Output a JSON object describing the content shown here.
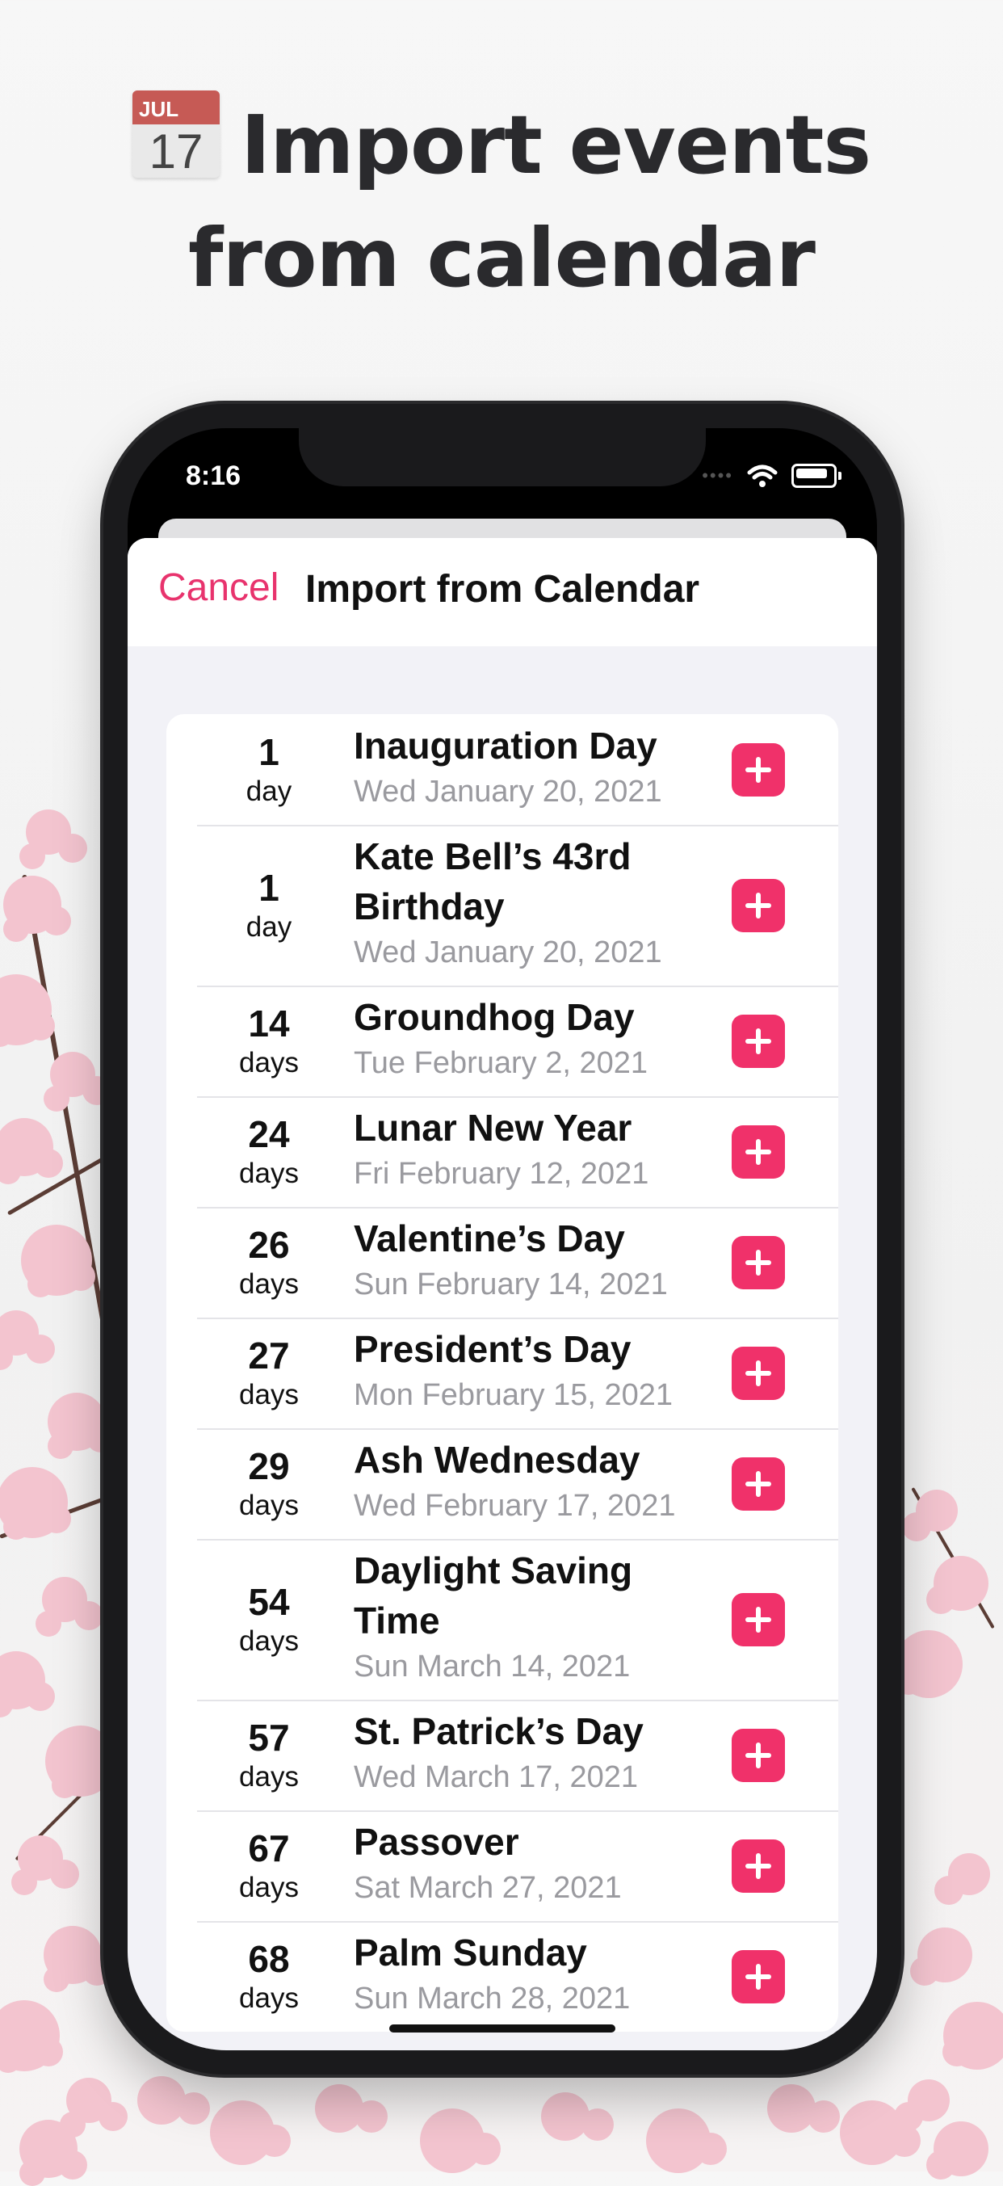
{
  "headline": {
    "calendar_icon_month": "JUL",
    "calendar_icon_day": "17",
    "line1": "Import events",
    "line2": "from calendar"
  },
  "status_bar": {
    "time": "8:16"
  },
  "navbar": {
    "cancel_label": "Cancel",
    "title": "Import from Calendar"
  },
  "accent_color": "#f0316a",
  "cancel_color": "#e8336d",
  "events": [
    {
      "count": "1",
      "unit": "day",
      "title": "Inauguration Day",
      "date": "Wed January 20, 2021"
    },
    {
      "count": "1",
      "unit": "day",
      "title": "Kate Bell’s 43rd Birthday",
      "date": "Wed January 20, 2021"
    },
    {
      "count": "14",
      "unit": "days",
      "title": "Groundhog Day",
      "date": "Tue February 2, 2021"
    },
    {
      "count": "24",
      "unit": "days",
      "title": "Lunar New Year",
      "date": "Fri February 12, 2021"
    },
    {
      "count": "26",
      "unit": "days",
      "title": "Valentine’s Day",
      "date": "Sun February 14, 2021"
    },
    {
      "count": "27",
      "unit": "days",
      "title": "President’s Day",
      "date": "Mon February 15, 2021"
    },
    {
      "count": "29",
      "unit": "days",
      "title": "Ash Wednesday",
      "date": "Wed February 17, 2021"
    },
    {
      "count": "54",
      "unit": "days",
      "title": "Daylight Saving Time",
      "date": "Sun March 14, 2021"
    },
    {
      "count": "57",
      "unit": "days",
      "title": "St. Patrick’s Day",
      "date": "Wed March 17, 2021"
    },
    {
      "count": "67",
      "unit": "days",
      "title": "Passover",
      "date": "Sat March 27, 2021"
    },
    {
      "count": "68",
      "unit": "days",
      "title": "Palm Sunday",
      "date": "Sun March 28, 2021"
    }
  ]
}
